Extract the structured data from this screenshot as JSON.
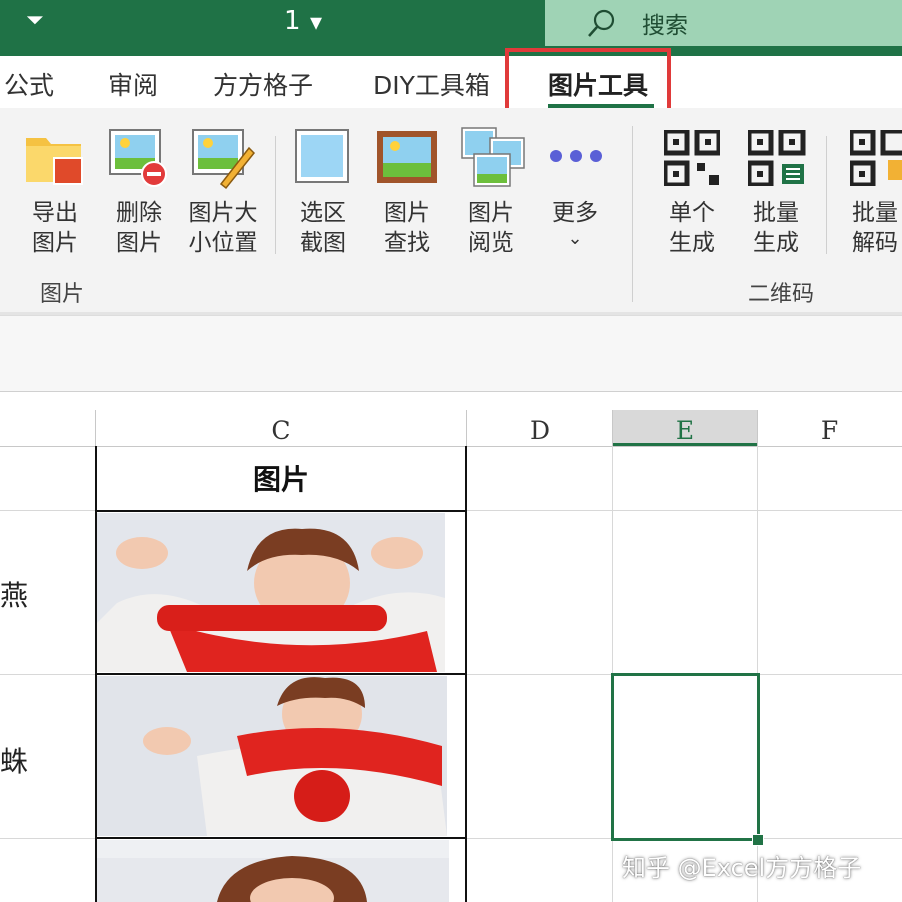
{
  "titlebar": {
    "qat_glyph": "⏷",
    "doc_name": "1",
    "dropdown_glyph": "▾",
    "search_placeholder": "搜索"
  },
  "tabs": [
    {
      "label": "公式"
    },
    {
      "label": "审阅"
    },
    {
      "label": "方方格子"
    },
    {
      "label": "DIY工具箱"
    },
    {
      "label": "图片工具"
    }
  ],
  "ribbon": {
    "group_picture": "图片",
    "group_qr": "二维码",
    "buttons": [
      {
        "line1": "导出",
        "line2": "图片"
      },
      {
        "line1": "删除",
        "line2": "图片"
      },
      {
        "line1": "图片大",
        "line2": "小位置"
      },
      {
        "line1": "选区",
        "line2": "截图"
      },
      {
        "line1": "图片",
        "line2": "查找"
      },
      {
        "line1": "图片",
        "line2": "阅览"
      },
      {
        "line1": "更多",
        "line2": "⌄"
      },
      {
        "line1": "单个",
        "line2": "生成"
      },
      {
        "line1": "批量",
        "line2": "生成"
      },
      {
        "line1": "批量",
        "line2": "解码"
      }
    ]
  },
  "sheet": {
    "columns": [
      "C",
      "D",
      "E",
      "F"
    ],
    "header_cell": "图片",
    "row_labels": [
      "燕",
      "蛛"
    ]
  },
  "colors": {
    "excel_green": "#1f7246",
    "search_bg": "#9fd3b5",
    "highlight_red": "#e03a3a",
    "selection_green": "#217346"
  },
  "watermark": "知乎 @Excel方方格子"
}
